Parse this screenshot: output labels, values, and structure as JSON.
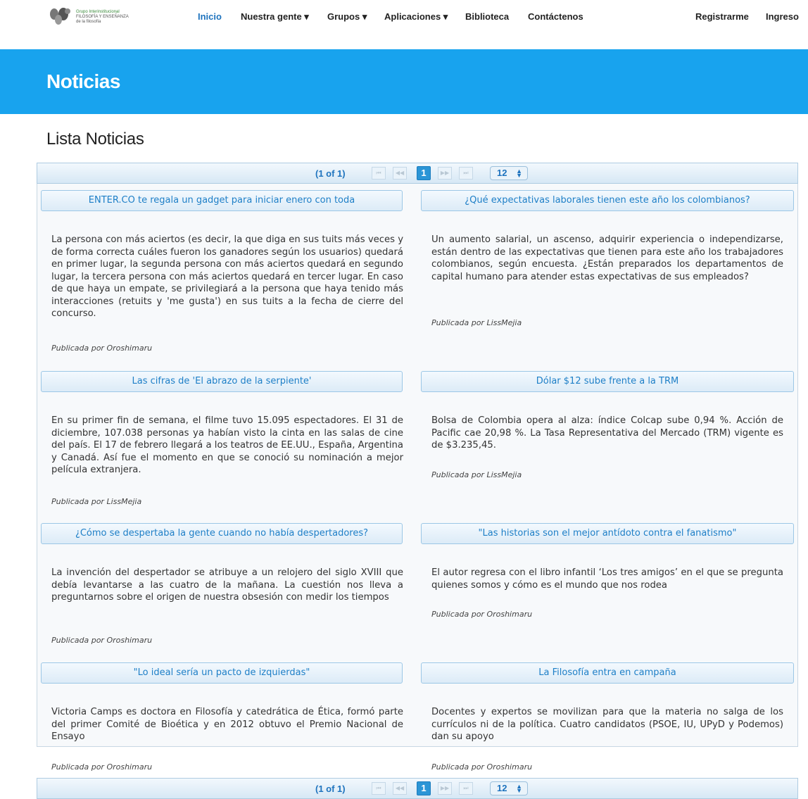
{
  "logo": {
    "line1": "Grupo Interinstitucional",
    "line2": "FILOSOFÍA Y ENSEÑANZA",
    "line3": "de la filosofía"
  },
  "nav": {
    "items": [
      {
        "label": "Inicio",
        "active": true
      },
      {
        "label": "Nuestra gente ▾"
      },
      {
        "label": "Grupos ▾"
      },
      {
        "label": "Aplicaciones ▾"
      },
      {
        "label": "Biblioteca"
      },
      {
        "label": "Contáctenos"
      }
    ],
    "register": "Registrarme",
    "login": "Ingreso"
  },
  "banner": {
    "title": "Noticias"
  },
  "section_title": "Lista Noticias",
  "paginator": {
    "current": "(1 of 1)",
    "first": "⏮",
    "prev": "◀◀",
    "page": "1",
    "next": "▶▶",
    "last": "⏭",
    "rows_per_page": "12"
  },
  "news": [
    {
      "title": "ENTER.CO te regala un gadget para iniciar enero con toda",
      "body": "La persona con más aciertos (es decir, la que diga en sus tuits más veces y de forma correcta cuáles fueron los ganadores según los usuarios) quedará en primer lugar, la segunda persona con más aciertos quedará en segundo lugar, la tercera persona con más aciertos quedará en tercer lugar. En caso de que haya un empate, se privilegiará a la persona que haya tenido más interacciones (retuits y 'me gusta') en sus tuits a la fecha de cierre del concurso.",
      "author": "Publicada por Oroshimaru"
    },
    {
      "title": "¿Qué expectativas laborales tienen este año los colombianos?",
      "body": "Un aumento salarial, un ascenso, adquirir experiencia o independizarse, están dentro de las expectativas que tienen para este año los trabajadores colombianos, según encuesta. ¿Están preparados los departamentos de capital humano para atender estas expectativas de sus empleados?",
      "author": "Publicada por LissMejia"
    },
    {
      "title": "Las cifras de 'El abrazo de la serpiente'",
      "body": "En su primer fin de semana, el filme tuvo 15.095 espectadores. El 31 de diciembre, 107.038 personas ya habían visto la cinta en las salas de cine del país. El 17 de febrero llegará a los teatros de EE.UU., España, Argentina y Canadá. Así fue el momento en que se conoció su nominación a mejor película extranjera.",
      "author": "Publicada por LissMejia"
    },
    {
      "title": "Dólar $12 sube frente a la TRM",
      "body": "Bolsa de Colombia opera al alza: índice Colcap sube 0,94 %. Acción de Pacific cae 20,98 %. La Tasa Representativa del Mercado (TRM) vigente es de $3.235,45.",
      "author": "Publicada por LissMejia"
    },
    {
      "title": "¿Cómo se despertaba la gente cuando no había despertadores?",
      "body": "La invención del despertador se atribuye a un relojero del siglo XVIII que debía levantarse a las cuatro de la mañana. La cuestión nos lleva a preguntarnos sobre el origen de nuestra obsesión con medir los tiempos",
      "author": "Publicada por Oroshimaru"
    },
    {
      "title": "\"Las historias son el mejor antídoto contra el fanatismo\"",
      "body": "El autor regresa con el libro infantil ‘Los tres amigos’ en el que se pregunta quienes somos y cómo es el mundo que nos rodea",
      "author": "Publicada por Oroshimaru"
    },
    {
      "title": "\"Lo ideal sería un pacto de izquierdas\"",
      "body": "Victoria Camps es doctora en Filosofía y catedrática de Ética, formó parte del primer Comité de Bioética y en 2012 obtuvo el Premio Nacional de Ensayo",
      "author": "Publicada por Oroshimaru"
    },
    {
      "title": "La Filosofía entra en campaña",
      "body": "Docentes y expertos se movilizan para que la materia no salga de los currículos ni de la política. Cuatro candidatos (PSOE, IU, UPyD y Podemos) dan su apoyo",
      "author": "Publicada por Oroshimaru"
    }
  ]
}
